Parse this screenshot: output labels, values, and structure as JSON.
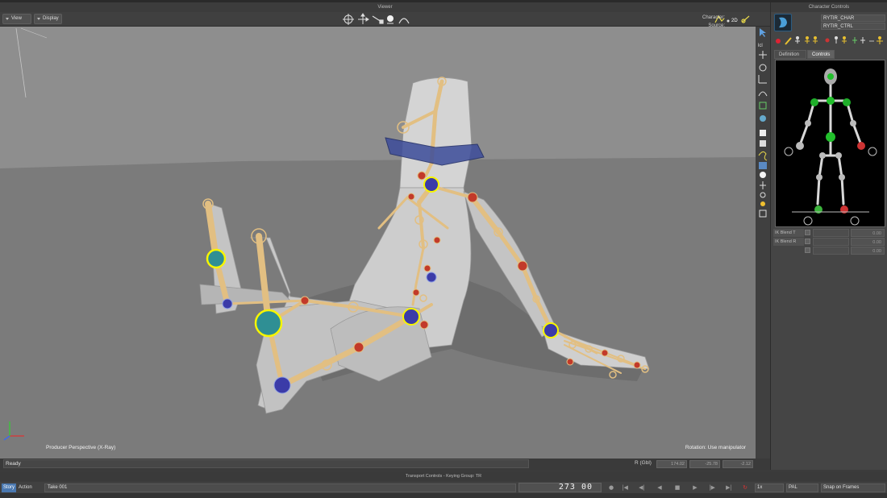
{
  "viewer": {
    "title": "Viewer",
    "menus": [
      {
        "label": "View"
      },
      {
        "label": "Display"
      }
    ],
    "tool_icons": [
      "rotate-gizmo-icon",
      "translate-icon",
      "scale-icon",
      "sphere-icon",
      "arc-icon"
    ],
    "right_badge": "2D",
    "viewport_label": "Producer Perspective (X-Ray)",
    "manipulator_label": "Rotation: Use manipulator"
  },
  "tools": [
    "select-arrow-icon",
    "local-icon",
    "move-icon",
    "rotate-icon",
    "scale-icon",
    "curve-icon",
    "constraint-icon",
    "bone-icon",
    "cube-icon",
    "cube-alt-icon",
    "path-icon",
    "camera-icon",
    "sphere-icon",
    "light-icon",
    "marker-icon",
    "sun-icon",
    "frame-icon"
  ],
  "character_controls": {
    "title": "Character Controls",
    "character_label": "Character:",
    "character_value": "RYTIR_CHAR",
    "source_label": "Source:",
    "source_value": "RYTIR_CTRL",
    "tabs": [
      {
        "label": "Definition"
      },
      {
        "label": "Controls"
      }
    ],
    "active_tab": "Controls",
    "ik_rows": [
      {
        "label": "IK Blend T",
        "value": "0.00"
      },
      {
        "label": "IK Blend R",
        "value": "0.00"
      },
      {
        "label": "",
        "value": "0.00"
      }
    ]
  },
  "status": {
    "text": "Ready",
    "space_label": "R (Gbl)",
    "coords": [
      "174.02",
      "-25.78",
      "-2.12"
    ]
  },
  "transport": {
    "title": "Transport Controls  -  Keying Group: TR",
    "story_label": "Story",
    "action_label": "Action",
    "take_value": "Take 001",
    "frame_value": "273 00",
    "speed_value": "1x",
    "format_value": "PAL",
    "snap_value": "Snap on Frames"
  },
  "colors": {
    "viewport_bg": "#8d8d8d",
    "ground": "#7b7b7b",
    "bone": "#e2bf82",
    "effector_selected": "#f7f500",
    "pivot_red": "#c23a2a",
    "pivot_blue": "#3b3ba8"
  }
}
